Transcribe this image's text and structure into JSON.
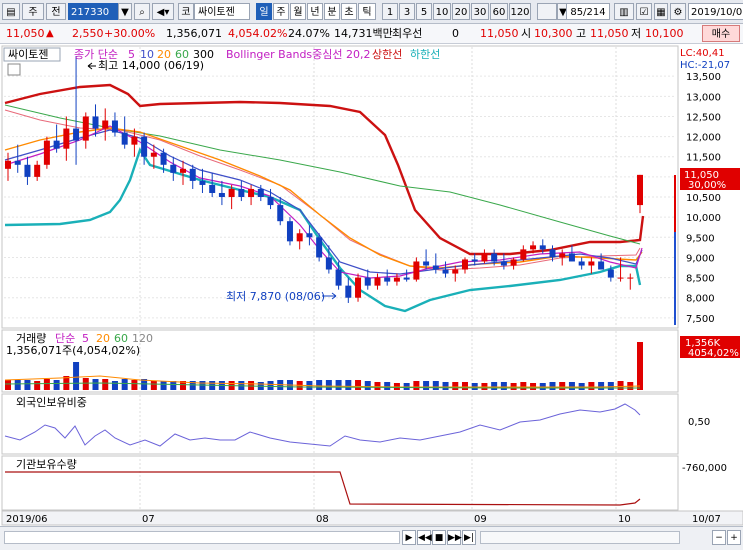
{
  "toolbar": {
    "market": "주",
    "type": "전",
    "code": "217330",
    "exchange_prefix": "코",
    "name": "싸이토젠",
    "period_tabs": [
      "일",
      "주",
      "월",
      "년",
      "분",
      "초",
      "틱"
    ],
    "minute_options": [
      "1",
      "3",
      "5",
      "10",
      "20",
      "30",
      "60",
      "120"
    ],
    "page_count": "85/214",
    "date": "2019/10/0"
  },
  "quote": {
    "price": "11,050",
    "change": "2,550",
    "change_pct": "+30.00%",
    "volume": "1,356,071",
    "volume_pct": "4,054.02%",
    "turnover_pct": "24.07%",
    "amount": "14,731백만",
    "best_ask_label": "최우선",
    "best_ask_value": "0",
    "last": "11,050",
    "open_label": "시",
    "open": "10,300",
    "high_label": "고",
    "high": "11,050",
    "low_label": "저",
    "low": "10,100",
    "buy_button": "매수"
  },
  "panels": {
    "price": {
      "stock_label": "싸이토젠",
      "ma_label": "종가 단순",
      "ma_periods": [
        "5",
        "10",
        "20",
        "60",
        "300"
      ],
      "bb_label": "Bollinger Bands중심선 20,2",
      "bb_upper": "상한선",
      "bb_lower": "하한선",
      "lc": "LC:40,41",
      "hc": "HC:-21,07",
      "high_note": "최고 14,000 (06/19)",
      "low_note": "최저 7,870 (08/06)",
      "price_tag": "11,050",
      "price_tag_pct": "30,00%"
    },
    "volume": {
      "label": "거래량",
      "ma_label": "단순",
      "ma_periods": [
        "5",
        "20",
        "60",
        "120"
      ],
      "value": "1,356,071주(4,054,02%)",
      "tag": "1,356K",
      "tag_pct": "4054,02%"
    },
    "foreign": {
      "label": "외국인보유비중",
      "tick": "0,50"
    },
    "institution": {
      "label": "기관보유수량",
      "tick": "-760,000"
    }
  },
  "colors": {
    "up": "#e00000",
    "down": "#1040c0",
    "bb_mid": "#cc1111",
    "bb_outer": "#1ab0b8",
    "ma5": "#c21ec2",
    "ma10": "#3f4fc8",
    "ma20": "#ff8a00",
    "ma60": "#3aa84b",
    "foreign_line": "#6b63d9",
    "institution_line": "#aa1010"
  },
  "chart_data": {
    "type": "line",
    "title": "싸이토젠",
    "x_months": [
      "2019/06",
      "07",
      "08",
      "09",
      "10",
      "10/07"
    ],
    "ylim": [
      7000,
      14000
    ],
    "y_ticks": [
      7500,
      8000,
      8500,
      9000,
      9500,
      10000,
      10500,
      11000,
      11500,
      12000,
      12500,
      13000,
      13500
    ],
    "candles": [
      [
        11200,
        11600,
        10900,
        11400
      ],
      [
        11400,
        11800,
        11100,
        11300
      ],
      [
        11300,
        11500,
        10800,
        11000
      ],
      [
        11000,
        11400,
        10900,
        11300
      ],
      [
        11300,
        12000,
        11200,
        11900
      ],
      [
        11900,
        12300,
        11600,
        11700
      ],
      [
        11700,
        12500,
        11400,
        12200
      ],
      [
        12200,
        14000,
        11300,
        11900
      ],
      [
        11900,
        12600,
        11700,
        12500
      ],
      [
        12500,
        12800,
        12000,
        12200
      ],
      [
        12200,
        12700,
        11900,
        12400
      ],
      [
        12400,
        12600,
        12000,
        12100
      ],
      [
        12100,
        12500,
        11700,
        11800
      ],
      [
        11800,
        12200,
        11500,
        12000
      ],
      [
        12000,
        12100,
        11300,
        11500
      ],
      [
        11500,
        11800,
        11200,
        11600
      ],
      [
        11600,
        11700,
        11100,
        11300
      ],
      [
        11300,
        11500,
        10900,
        11100
      ],
      [
        11100,
        11400,
        10800,
        11200
      ],
      [
        11200,
        11300,
        10700,
        10900
      ],
      [
        10900,
        11200,
        10600,
        10800
      ],
      [
        10800,
        11100,
        10500,
        10600
      ],
      [
        10600,
        10900,
        10300,
        10500
      ],
      [
        10500,
        10800,
        10200,
        10700
      ],
      [
        10700,
        10900,
        10400,
        10500
      ],
      [
        10500,
        10800,
        10300,
        10700
      ],
      [
        10700,
        10800,
        10400,
        10500
      ],
      [
        10500,
        10700,
        10200,
        10300
      ],
      [
        10300,
        10500,
        9800,
        9900
      ],
      [
        9900,
        10000,
        9300,
        9400
      ],
      [
        9400,
        9700,
        9200,
        9600
      ],
      [
        9600,
        9800,
        9300,
        9500
      ],
      [
        9500,
        9600,
        8900,
        9000
      ],
      [
        9000,
        9300,
        8600,
        8700
      ],
      [
        8700,
        8900,
        8200,
        8300
      ],
      [
        8300,
        8500,
        7870,
        8000
      ],
      [
        8000,
        8600,
        7900,
        8500
      ],
      [
        8500,
        8700,
        8200,
        8300
      ],
      [
        8300,
        8600,
        8200,
        8500
      ],
      [
        8500,
        8700,
        8300,
        8400
      ],
      [
        8400,
        8600,
        8300,
        8500
      ],
      [
        8500,
        8700,
        8400,
        8450
      ],
      [
        8450,
        9000,
        8400,
        8900
      ],
      [
        8900,
        9200,
        8700,
        8800
      ],
      [
        8800,
        9100,
        8600,
        8700
      ],
      [
        8700,
        8900,
        8500,
        8600
      ],
      [
        8600,
        8800,
        8400,
        8700
      ],
      [
        8700,
        9000,
        8600,
        8950
      ],
      [
        8950,
        9100,
        8800,
        8900
      ],
      [
        8900,
        9200,
        8850,
        9100
      ],
      [
        9100,
        9200,
        8800,
        8900
      ],
      [
        8900,
        9100,
        8700,
        8800
      ],
      [
        8800,
        9000,
        8700,
        8950
      ],
      [
        8950,
        9300,
        8900,
        9200
      ],
      [
        9200,
        9400,
        9100,
        9300
      ],
      [
        9300,
        9450,
        9100,
        9200
      ],
      [
        9200,
        9300,
        8900,
        9000
      ],
      [
        9000,
        9200,
        8800,
        9100
      ],
      [
        9100,
        9300,
        8900,
        8900
      ],
      [
        8900,
        9000,
        8700,
        8800
      ],
      [
        8800,
        9000,
        8600,
        8900
      ],
      [
        8900,
        9100,
        8700,
        8700
      ],
      [
        8700,
        8800,
        8400,
        8500
      ],
      [
        8500,
        9000,
        8400,
        8500
      ],
      [
        8500,
        8600,
        8200,
        8500
      ],
      [
        10300,
        11050,
        10100,
        11050
      ]
    ]
  }
}
